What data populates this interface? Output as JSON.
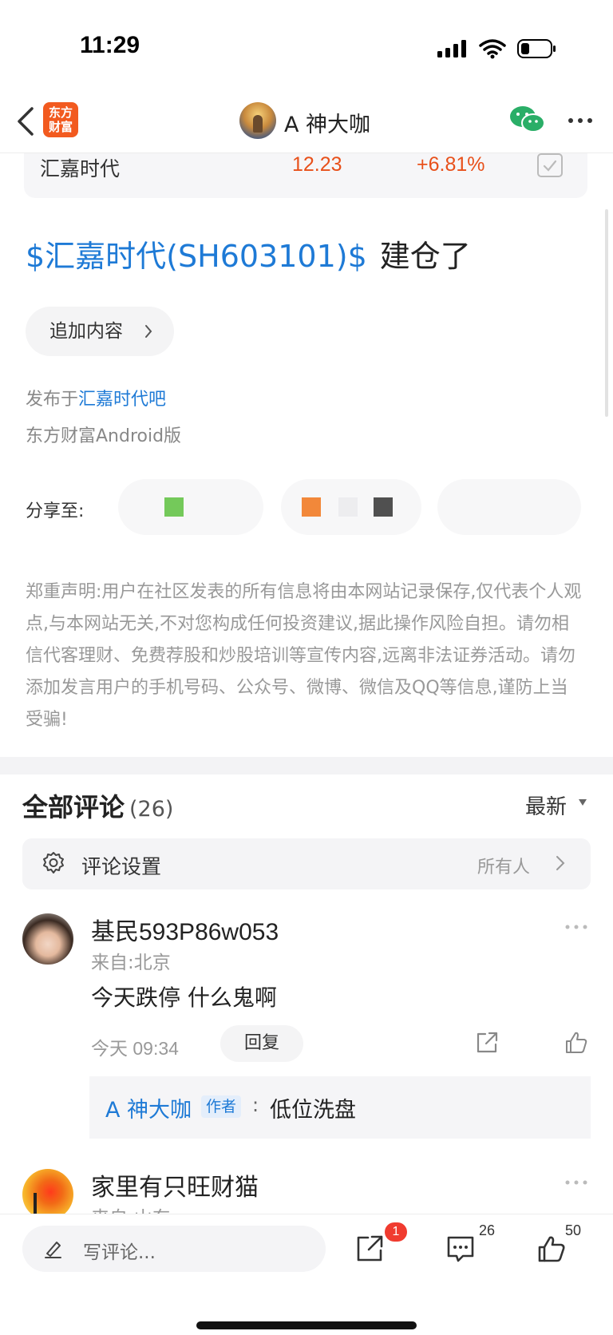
{
  "status_bar": {
    "time": "11:29"
  },
  "nav": {
    "app_logo_line1": "东方",
    "app_logo_line2": "财富",
    "title": "A 神大咖"
  },
  "stock_card": {
    "name": "汇嘉时代",
    "price": "12.23",
    "change": "+6.81%"
  },
  "post": {
    "stock_link": "$汇嘉时代(SH603101)$",
    "text": "建仓了",
    "add_content_label": "追加内容",
    "published_prefix": "发布于",
    "published_forum": "汇嘉时代吧",
    "client": "东方财富Android版",
    "share_label": "分享至:"
  },
  "disclaimer": "郑重声明:用户在社区发表的所有信息将由本网站记录保存,仅代表个人观点,与本网站无关,不对您构成任何投资建议,据此操作风险自担。请勿相信代客理财、免费荐股和炒股培训等宣传内容,远离非法证券活动。请勿添加发言用户的手机号码、公众号、微博、微信及QQ等信息,谨防上当受骗!",
  "comments": {
    "header": "全部评论",
    "count": "(26)",
    "sort": "最新",
    "settings_label": "评论设置",
    "settings_value": "所有人",
    "items": [
      {
        "user": "基民593P86w053",
        "from": "来自:北京",
        "text": "今天跌停 什么鬼啊",
        "time": "今天 09:34",
        "reply_label": "回复",
        "reply": {
          "author": "A 神大咖",
          "badge": "作者",
          "colon": ":",
          "text": "低位洗盘"
        }
      },
      {
        "user": "家里有只旺财猫",
        "from": "来自:山东"
      }
    ]
  },
  "bottom_bar": {
    "placeholder": "写评论...",
    "share_badge": "1",
    "comment_count": "26",
    "like_count": "50"
  },
  "colors": {
    "link_blue": "#1e7ad6",
    "price_red": "#e8501a",
    "brand_orange": "#f25a1f",
    "badge_red": "#f03b2f"
  }
}
